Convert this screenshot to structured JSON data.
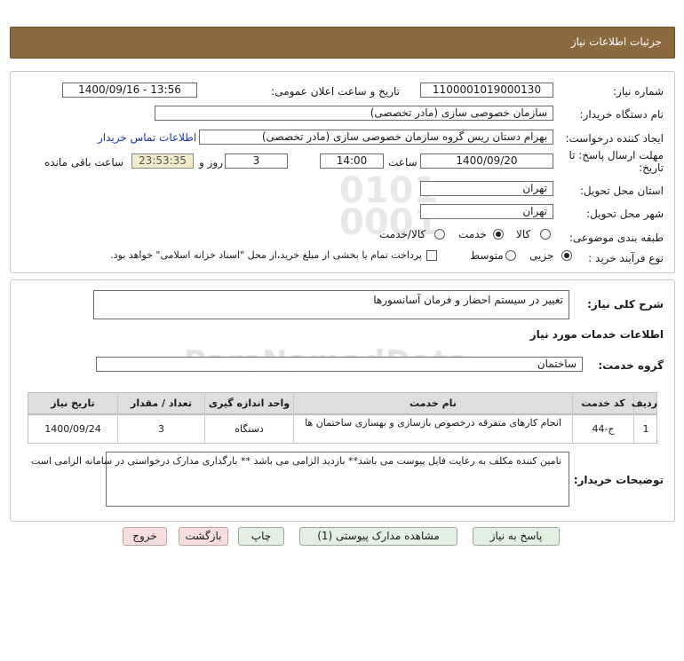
{
  "header": {
    "title": "جزئیات اطلاعات نیاز"
  },
  "need_info": {
    "need_number_label": "شماره نیاز:",
    "need_number": "1100001019000130",
    "announce_label": "تاریخ و ساعت اعلان عمومی:",
    "announce_value": "1400/09/16 - 13:56",
    "buyer_org_label": "نام دستگاه خریدار:",
    "buyer_org": "سازمان خصوصی سازی (مادر تخصصی)",
    "creator_label": "ایجاد کننده درخواست:",
    "creator": "بهرام دستان ریس گروه سازمان خصوصی سازی (مادر تخصصی)",
    "contact_link": "اطلاعات تماس خریدار",
    "deadline_label_1": "مهلت ارسال پاسخ: تا",
    "deadline_label_2": "تاریخ:",
    "deadline_date": "1400/09/20",
    "time_label": "ساعت",
    "deadline_time": "14:00",
    "days_value": "3",
    "days_label": "روز و",
    "remaining_time": "23:53:35",
    "remaining_label": "ساعت باقی مانده",
    "province_label": "استان محل تحویل:",
    "province": "تهران",
    "city_label": "شهر محل تحویل:",
    "city": "تهران",
    "category_label": "طبقه بندی موضوعی:",
    "category_options": [
      "کالا",
      "خدمت",
      "کالا/خدمت"
    ],
    "category_selected": "خدمت",
    "process_label": "نوع فرآیند خرید :",
    "process_options": [
      "جزیی",
      "متوسط"
    ],
    "process_selected": "جزیی",
    "payment_note": "پرداخت تمام یا بخشی از مبلغ خرید،از محل \"اسناد خزانه اسلامی\" خواهد بود."
  },
  "details": {
    "summary_label": "شرح کلی نیاز:",
    "summary": "تغییر در سیستم احضار و فرمان آسانسورها",
    "services_title": "اطلاعات خدمات مورد نیاز",
    "service_group_label": "گروه خدمت:",
    "service_group": "ساختمان",
    "table": {
      "headers": [
        "ردیف",
        "کد خدمت",
        "نام خدمت",
        "واحد اندازه گیری",
        "تعداد / مقدار",
        "تاریخ نیاز"
      ],
      "rows": [
        [
          "1",
          "ج-44",
          "انجام کارهای متفرقه درخصوص بازسازی و بهسازی ساختمان ها",
          "دستگاه",
          "3",
          "1400/09/24"
        ]
      ]
    },
    "buyer_notes_label": "توضیحات خریدار:",
    "buyer_notes": "تامین کننده مکلف به رعایت فایل پیوست می باشد** بازدید الزامی می باشد ** بارگذاری مدارک درخواستی در سامانه الزامی است"
  },
  "buttons": {
    "reply": "پاسخ به نیاز",
    "attachments": "مشاهده مدارک پیوستی (1)",
    "print": "چاپ",
    "back": "بازگشت",
    "exit": "خروج"
  },
  "colors": {
    "header_bg": "#8b6a40",
    "timer_bg": "#f0ebc8",
    "button_bg": "#e2efe2",
    "button_red_bg": "#f6dede",
    "link": "#1a35b0"
  }
}
